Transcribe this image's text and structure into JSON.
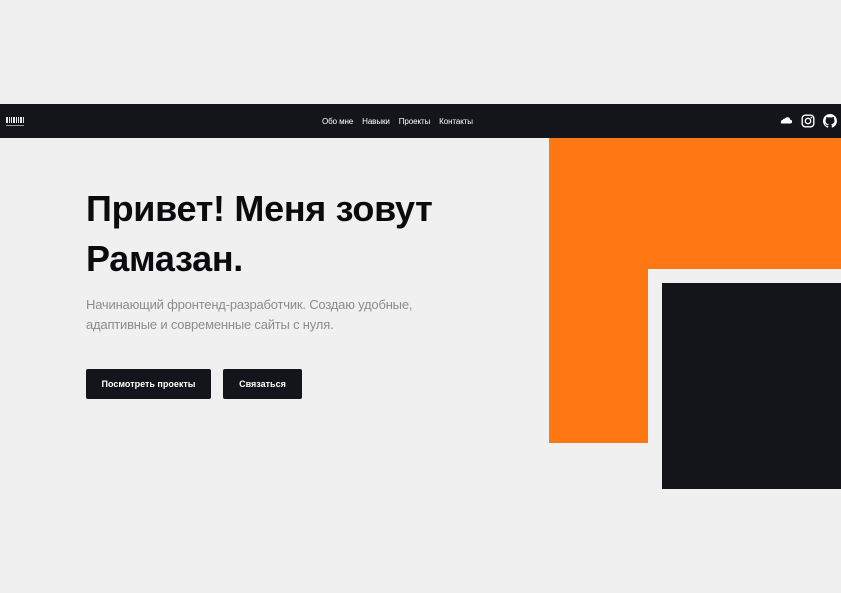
{
  "nav": {
    "logo_icon": "barcode-logo-icon",
    "links": [
      {
        "label": "Обо мне"
      },
      {
        "label": "Навыки"
      },
      {
        "label": "Проекты"
      },
      {
        "label": "Контакты"
      }
    ],
    "socials": [
      {
        "icon": "soundcloud-icon"
      },
      {
        "icon": "instagram-icon"
      },
      {
        "icon": "github-icon"
      }
    ]
  },
  "hero": {
    "title": "Привет! Меня зовут Рамазан.",
    "subtitle": "Начинающий фронтенд-разработчик. Создаю удобные, адаптивные и современные сайты с нуля.",
    "buttons": {
      "projects": "Посмотреть проекты",
      "contact": "Связаться"
    }
  },
  "colors": {
    "background": "#f0f0f0",
    "dark": "#14151a",
    "accent": "#ff7712",
    "subtitle": "#8c8c8c"
  }
}
